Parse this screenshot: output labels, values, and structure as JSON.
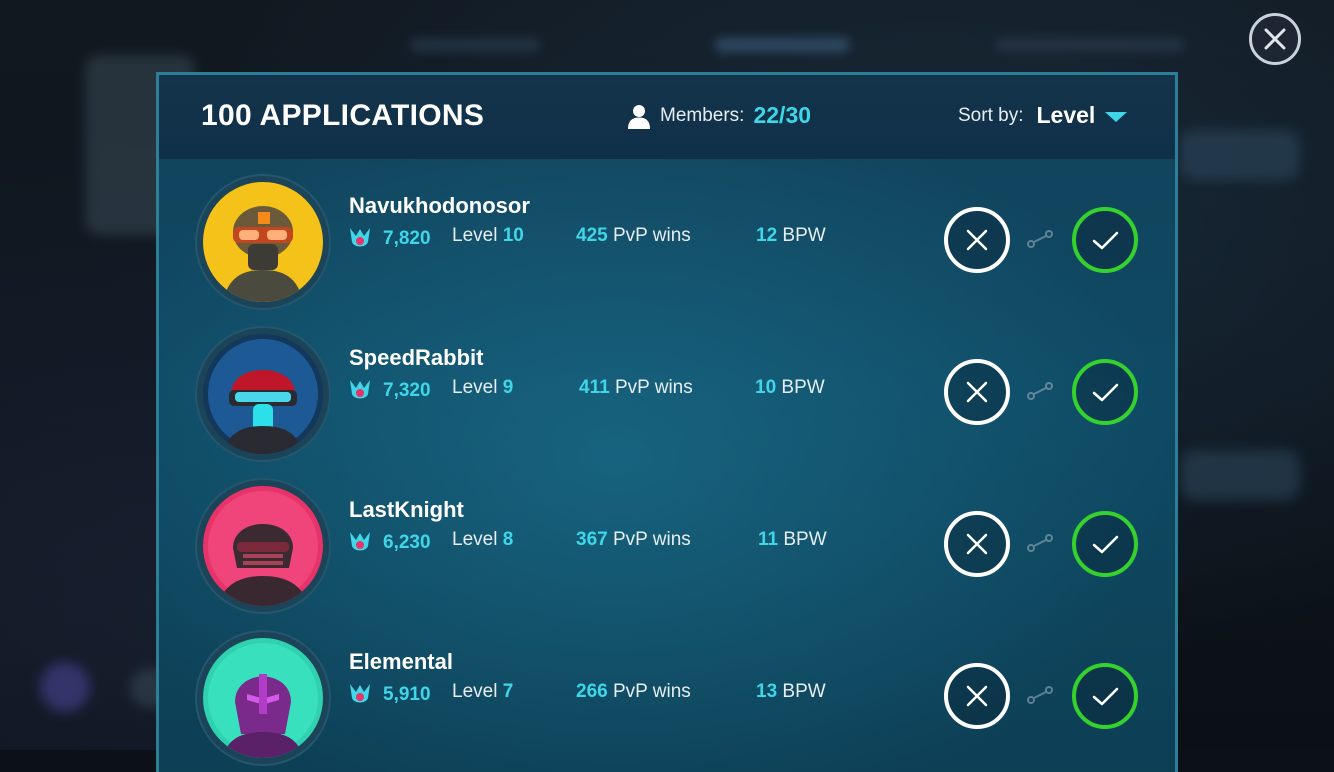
{
  "header": {
    "title": "100 APPLICATIONS",
    "members_label": "Members:",
    "members_value": "22/30",
    "sort_label": "Sort by:",
    "sort_value": "Level"
  },
  "icons": {
    "close": "close-icon",
    "member": "person-icon",
    "sort": "caret-down-icon",
    "trophy": "trophy-icon",
    "decline": "x-icon",
    "accept": "checkmark-icon",
    "link": "link-icon"
  },
  "colors": {
    "accent": "#3ed6e8",
    "accept": "#35d22e",
    "panel_border": "#2d7f98"
  },
  "applicants": [
    {
      "name": "Navukhodonosor",
      "trophies": "7,820",
      "level_label": "Level",
      "level": "10",
      "pvp_wins": "425",
      "pvp_label": "PvP wins",
      "bpw": "12",
      "bpw_label": "BPW",
      "avatar_color": "#f5c21a"
    },
    {
      "name": "SpeedRabbit",
      "trophies": "7,320",
      "level_label": "Level",
      "level": "9",
      "pvp_wins": "411",
      "pvp_label": "PvP wins",
      "bpw": "10",
      "bpw_label": "BPW",
      "avatar_color": "#1a5a9a"
    },
    {
      "name": "LastKnight",
      "trophies": "6,230",
      "level_label": "Level",
      "level": "8",
      "pvp_wins": "367",
      "pvp_label": "PvP wins",
      "bpw": "11",
      "bpw_label": "BPW",
      "avatar_color": "#e8336a"
    },
    {
      "name": "Elemental",
      "trophies": "5,910",
      "level_label": "Level",
      "level": "7",
      "pvp_wins": "266",
      "pvp_label": "PvP wins",
      "bpw": "13",
      "bpw_label": "BPW",
      "avatar_color": "#2fd1b0"
    }
  ]
}
